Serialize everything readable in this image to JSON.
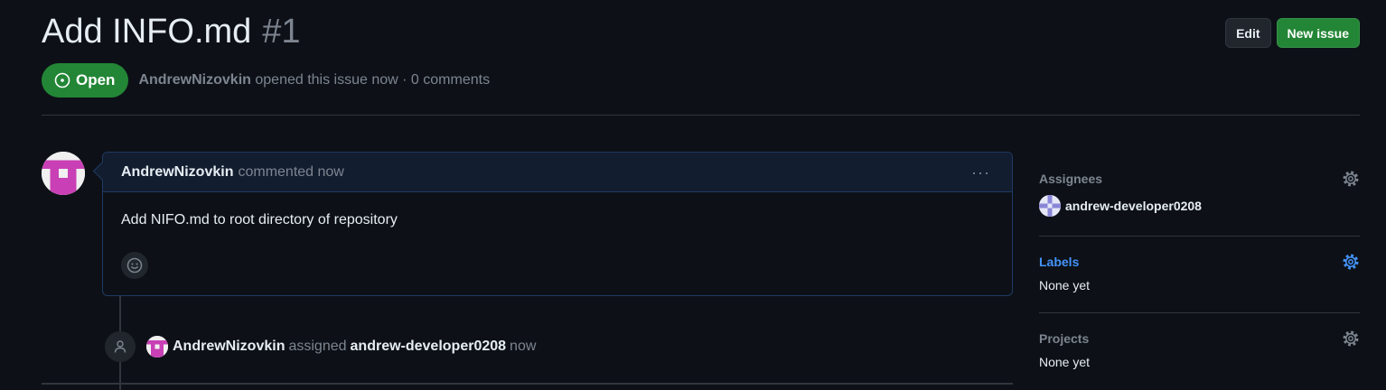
{
  "issue": {
    "title": "Add INFO.md",
    "number": "#1",
    "state": "Open",
    "author": "AndrewNizovkin",
    "opened_text": "opened this issue now · 0 comments"
  },
  "header_actions": {
    "edit_label": "Edit",
    "new_issue_label": "New issue"
  },
  "comment": {
    "author": "AndrewNizovkin",
    "when": "commented now",
    "body": "Add NIFO.md to root directory of repository",
    "menu_glyph": "···"
  },
  "event": {
    "actor": "AndrewNizovkin",
    "action": "assigned",
    "target": "andrew-developer0208",
    "when": "now"
  },
  "sidebar": {
    "assignees": {
      "heading": "Assignees",
      "user": "andrew-developer0208"
    },
    "labels": {
      "heading": "Labels",
      "value": "None yet"
    },
    "projects": {
      "heading": "Projects",
      "value": "None yet"
    }
  },
  "colors": {
    "background": "#0d1117",
    "open_green": "#238636",
    "link_blue": "#4493f8",
    "avatar_pink": "#c93fb5"
  },
  "icons": [
    "issue-open-icon",
    "kebab-icon",
    "smiley-icon",
    "person-icon",
    "gear-icon"
  ]
}
